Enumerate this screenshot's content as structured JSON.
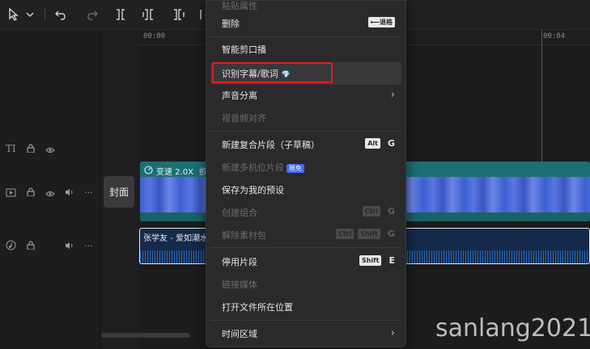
{
  "toolbar": {
    "icons": [
      "cursor-arrow-icon",
      "chevron-down-icon",
      "undo-icon",
      "redo-icon",
      "split-icon",
      "split-left-icon",
      "split-right-icon",
      "delete-icon"
    ]
  },
  "ruler": {
    "ticks": [
      "00:00",
      "00:04"
    ]
  },
  "tracks": [
    {
      "type": "text",
      "icons": [
        "text-track-icon",
        "lock-icon",
        "eye-icon"
      ]
    },
    {
      "type": "video",
      "icons": [
        "video-track-icon",
        "lock-icon",
        "eye-icon",
        "volume-icon",
        "more-icon"
      ]
    },
    {
      "type": "audio",
      "icons": [
        "audio-track-icon",
        "lock-icon",
        "volume-icon",
        "more-icon"
      ]
    }
  ],
  "cover_label": "封面",
  "video_clip": {
    "speed_label": "变速 2.0X",
    "title_fragment": "叡"
  },
  "audio_clip": {
    "title": "张学友 - 爱如潮水"
  },
  "menu": {
    "top_partial_label": "粘贴属性",
    "items": [
      {
        "label": "删除",
        "shortcut": "⟵退格",
        "disabled": false
      },
      {
        "label": "智能剪口播",
        "disabled": false
      },
      {
        "label": "识别字幕/歌词",
        "disabled": false,
        "highlighted": true,
        "gem": "💎"
      },
      {
        "label": "声音分离",
        "submenu": true,
        "disabled": false
      },
      {
        "label": "视音频对齐",
        "disabled": true
      },
      {
        "label": "新建复合片段（子草稿）",
        "mod": "Alt",
        "key": "G",
        "disabled": false
      },
      {
        "label": "新建多机位片段",
        "badge": "限免",
        "disabled": true
      },
      {
        "label": "保存为我的预设",
        "disabled": false
      },
      {
        "label": "创建组合",
        "mod": "Ctrl",
        "key": "G",
        "disabled": true
      },
      {
        "label": "解除素材包",
        "mod": "Ctrl",
        "mod2": "Shift",
        "key": "G",
        "disabled": true
      },
      {
        "label": "停用片段",
        "mod": "Shift",
        "key": "E",
        "disabled": false
      },
      {
        "label": "链接媒体",
        "disabled": true
      },
      {
        "label": "打开文件所在位置",
        "disabled": false
      },
      {
        "label": "时间区域",
        "submenu": true,
        "disabled": false
      }
    ],
    "chevron": "›"
  },
  "watermark": "sanlang2021"
}
